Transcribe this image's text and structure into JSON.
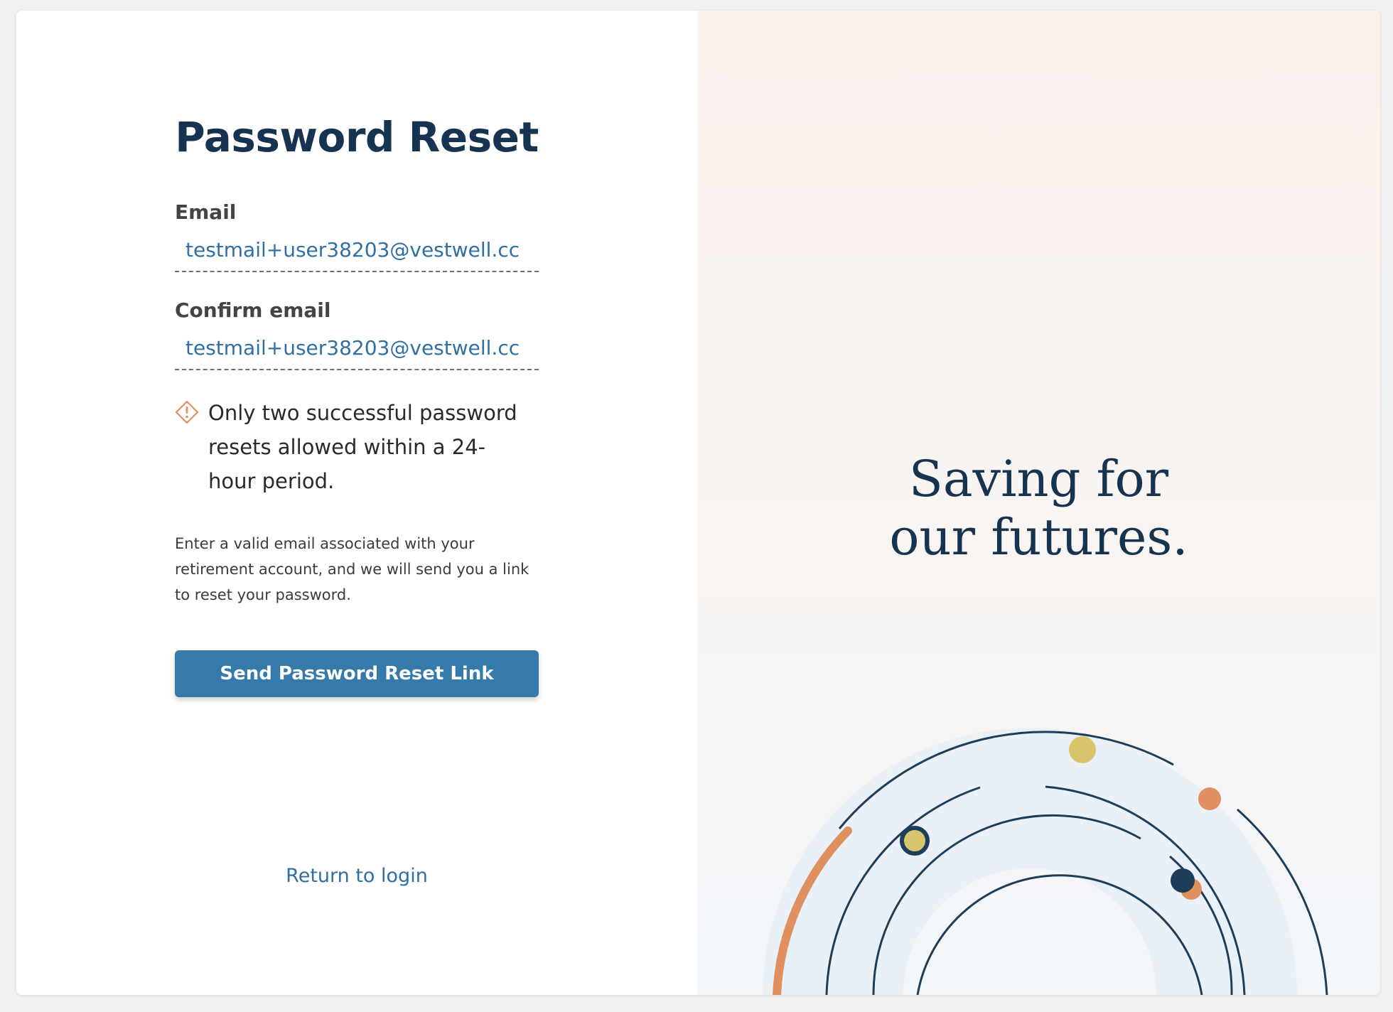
{
  "page": {
    "title": "Password Reset"
  },
  "form": {
    "email_label": "Email",
    "email_value": "testmail+user38203@vestwell.cc",
    "confirm_label": "Confirm email",
    "confirm_value": "testmail+user38203@vestwell.cc",
    "warning_text": "Only two successful password resets allowed within a 24-hour period.",
    "helper_text": "Enter a valid email associated with your retirement account, and we will send you a link to reset your password.",
    "submit_label": "Send Password Reset Link",
    "return_link": "Return to login"
  },
  "hero": {
    "line1": "Saving for",
    "line2": "our futures."
  },
  "icons": {
    "warning": "warning-diamond-icon"
  },
  "colors": {
    "brand_navy": "#16334f",
    "primary_button": "#357aab",
    "link": "#2f6fa3",
    "accent_orange": "#e0905f",
    "accent_gold": "#d8c46a",
    "hero_background": "#fbf2ed"
  }
}
